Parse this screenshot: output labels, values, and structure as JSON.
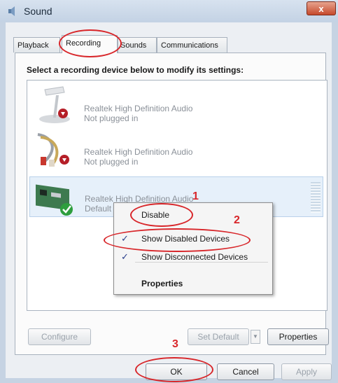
{
  "window": {
    "title": "Sound",
    "close_label": "x"
  },
  "tabs": [
    {
      "label": "Playback",
      "active": false
    },
    {
      "label": "Recording",
      "active": true
    },
    {
      "label": "Sounds",
      "active": false
    },
    {
      "label": "Communications",
      "active": false
    }
  ],
  "instruction": "Select a recording device below to modify its settings:",
  "devices": [
    {
      "name": "Realtek High Definition Audio",
      "status": "Not plugged in",
      "icon": "microphone-icon",
      "badge": "red-down-arrow"
    },
    {
      "name": "Realtek High Definition Audio",
      "status": "Not plugged in",
      "icon": "audio-cable-icon",
      "badge": "red-down-arrow"
    },
    {
      "name": "Realtek High Definition Audio",
      "status": "Default Device",
      "icon": "sound-card-icon",
      "badge": "green-check",
      "selected": true
    }
  ],
  "context_menu": {
    "items": [
      {
        "label": "Disable",
        "checked": false,
        "bold": false
      },
      {
        "label": "Show Disabled Devices",
        "checked": true,
        "bold": false
      },
      {
        "label": "Show Disconnected Devices",
        "checked": true,
        "bold": false
      },
      {
        "label": "Properties",
        "checked": false,
        "bold": true
      }
    ],
    "check_glyph": "✓"
  },
  "buttons": {
    "configure": "Configure",
    "set_default": "Set Default",
    "properties": "Properties",
    "ok": "OK",
    "cancel": "Cancel",
    "apply": "Apply"
  },
  "annotations": {
    "n1": "1",
    "n2": "2",
    "n3": "3"
  },
  "colors": {
    "callout_red": "#d8262a",
    "window_frame": "#c6d3e3",
    "selected_row": "#e6f0fa"
  }
}
